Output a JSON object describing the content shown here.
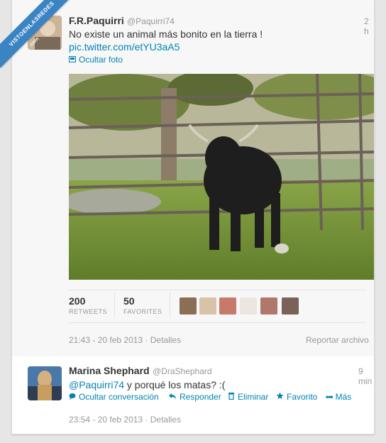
{
  "watermark": {
    "line1": "VISTOENLASREDES",
    "line2": ".com"
  },
  "tweet1": {
    "name": "F.R.Paquirri",
    "handle": "@Paquirri74",
    "time": "2 h",
    "text": "No existe un animal más bonito en la tierra !",
    "link": "pic.twitter.com/etYU3aA5",
    "hide_photo": "Ocultar foto",
    "retweets_count": "200",
    "retweets_label": "RETWEETS",
    "favorites_count": "50",
    "favorites_label": "FAVORITES",
    "timestamp": "21:43 - 20 feb 2013 · Detalles",
    "report": "Reportar archivo"
  },
  "tweet2": {
    "name": "Marina Shephard",
    "handle": "@DraShephard",
    "time": "9 min",
    "mention": "@Paquirri74",
    "text": " y porqué los matas? :(",
    "actions": {
      "hide_conversation": "Ocultar conversación",
      "reply": "Responder",
      "delete": "Eliminar",
      "favorite": "Favorito",
      "more": "Más"
    },
    "timestamp": "23:54 - 20 feb 2013 · Detalles"
  },
  "colors": {
    "link": "#0084b4",
    "ribbon": "#3b84c4"
  },
  "icons": [
    "photo-icon",
    "conversation-icon",
    "reply-icon",
    "trash-icon",
    "star-icon",
    "more-icon"
  ]
}
